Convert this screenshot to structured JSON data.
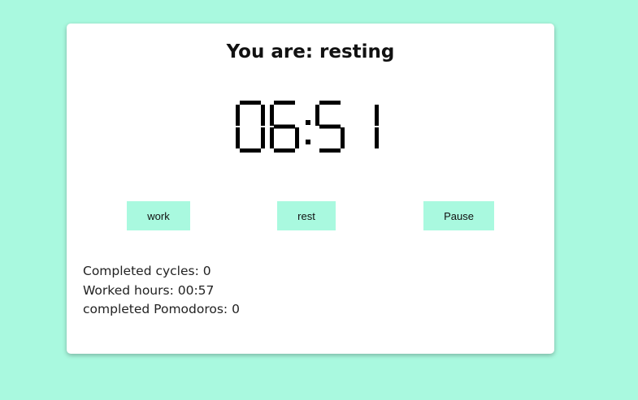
{
  "status": {
    "title": "You are: resting"
  },
  "timer": {
    "display": "06:51"
  },
  "controls": {
    "work_label": "work",
    "rest_label": "rest",
    "pause_label": "Pause"
  },
  "stats": {
    "completed_cycles": "Completed cycles: 0",
    "worked_hours": "Worked hours: 00:57",
    "completed_pomodoros": "completed Pomodoros: 0"
  },
  "colors": {
    "background": "#a9f9df",
    "card": "#ffffff",
    "button": "#a9f9df"
  }
}
